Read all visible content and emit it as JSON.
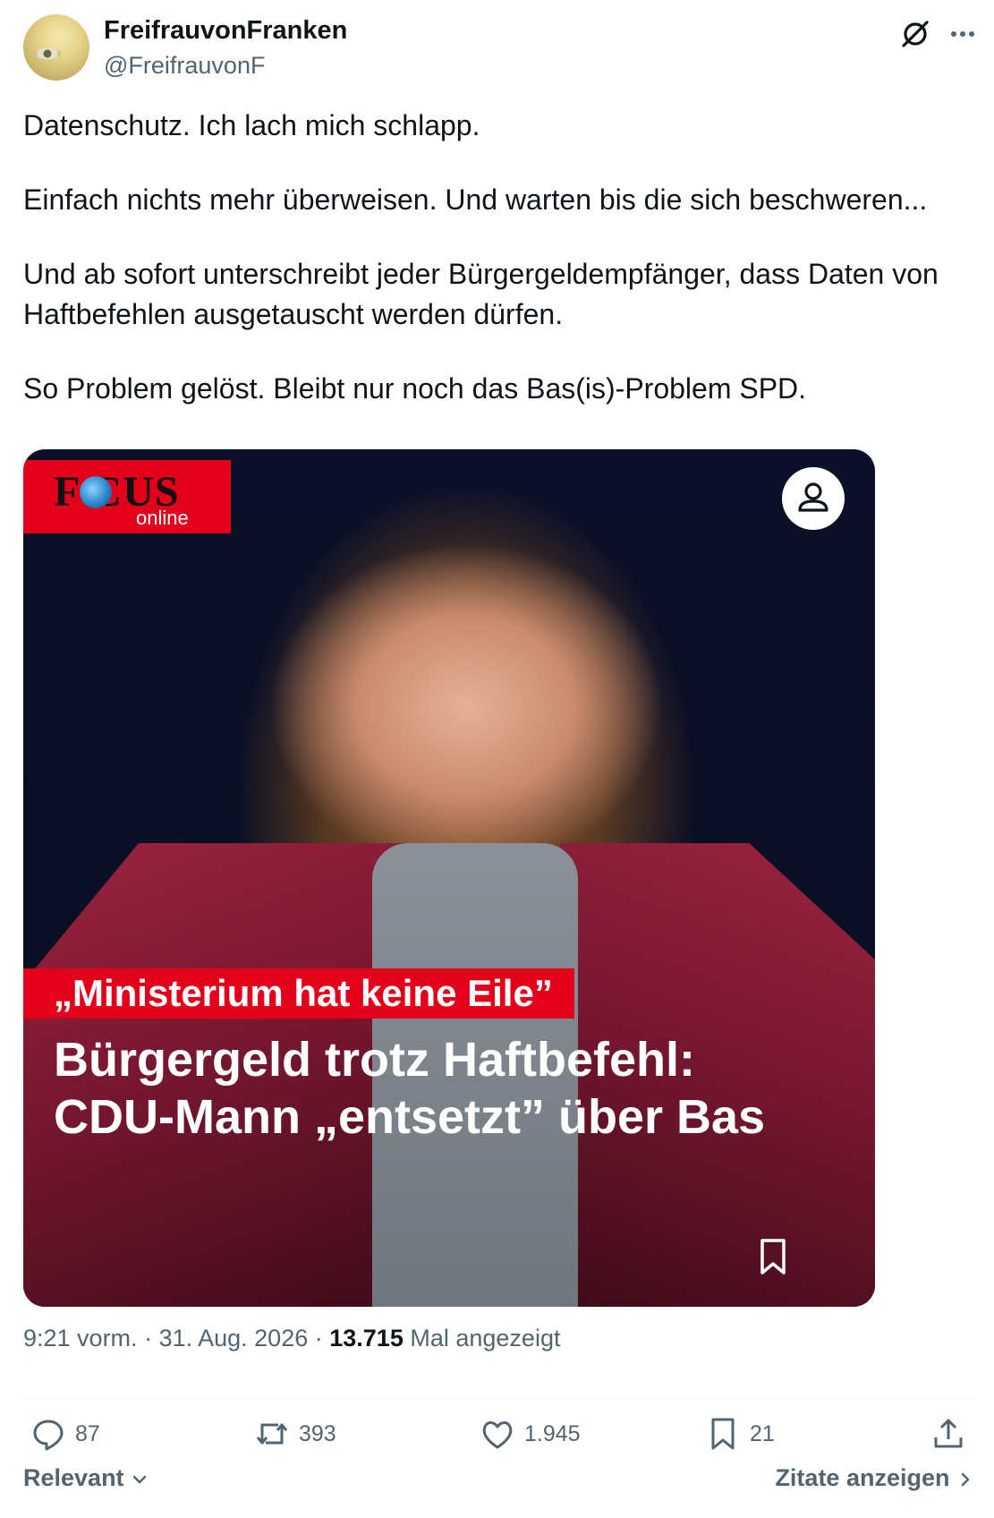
{
  "author": {
    "display_name": "FreifrauvonFranken",
    "handle": "@FreifrauvonF"
  },
  "tweet": {
    "paragraphs": [
      "Datenschutz. Ich lach mich schlapp.",
      "Einfach nichts mehr überweisen. Und warten bis die sich beschweren...",
      "Und ab sofort unterschreibt jeder Bürgergeldempfänger, dass Daten von Haftbefehlen ausgetauscht werden dürfen.",
      "So Problem gelöst. Bleibt nur noch das Bas(is)-Problem SPD."
    ]
  },
  "media": {
    "logo_word": "F CUS",
    "logo_sub": "online",
    "quote": "„Ministerium hat keine Eile”",
    "headline": "Bürgergeld trotz Haftbefehl: CDU-Mann „entsetzt” über Bas"
  },
  "meta": {
    "time": "9:21 vorm.",
    "date": "31. Aug. 2026",
    "views_count": "13.715",
    "views_label": "Mal angezeigt"
  },
  "actions": {
    "replies": "87",
    "reposts": "393",
    "likes": "1.945",
    "bookmarks": "21"
  },
  "footer": {
    "sort_label": "Relevant",
    "quotes_label": "Zitate anzeigen"
  },
  "icons": [
    "grok-icon",
    "more-icon",
    "globe-icon",
    "person-icon",
    "bookmark-icon",
    "reply-icon",
    "repost-icon",
    "like-icon",
    "share-icon",
    "chevron-down-icon",
    "chevron-right-icon"
  ],
  "colors": {
    "text_primary": "#0f1419",
    "text_secondary": "#536471",
    "focus_red": "#e2001a"
  }
}
